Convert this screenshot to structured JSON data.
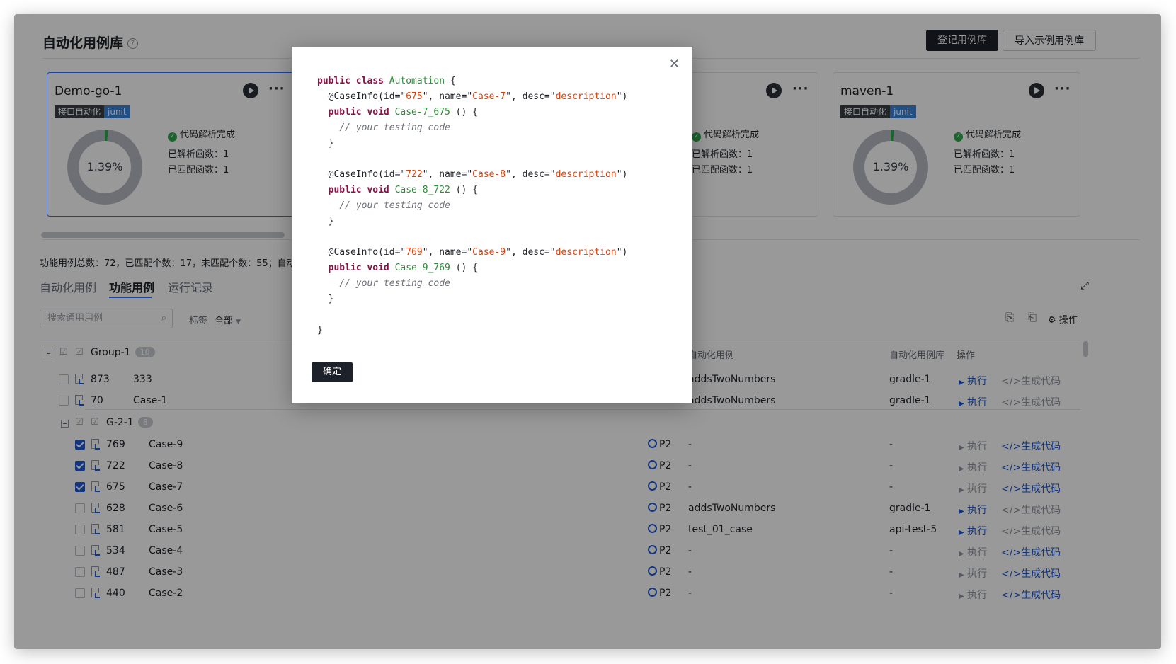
{
  "page": {
    "title": "自动化用例库",
    "help_icon": "question-circle-icon",
    "register_button": "登记用例库",
    "import_button": "导入示例用例库"
  },
  "cards": [
    {
      "name": "Demo-go-1",
      "tags": [
        "接口自动化",
        "junit"
      ],
      "percent": "1.39%",
      "status": "代码解析完成",
      "parsed": "已解析函数：1",
      "matched": "已匹配函数：1"
    },
    {
      "name": "",
      "tags": [],
      "percent": "",
      "status": "代码解析完成",
      "parsed": "已解析函数：1",
      "matched": "已匹配函数：1"
    },
    {
      "name": "maven-1",
      "tags": [
        "接口自动化",
        "junit"
      ],
      "percent": "1.39%",
      "status": "代码解析完成",
      "parsed": "已解析函数：1",
      "matched": "已匹配函数：1"
    }
  ],
  "summary": "功能用例总数：72，已匹配个数：17，未匹配个数：55；自动",
  "tabs": [
    "自动化用例",
    "功能用例",
    "运行记录"
  ],
  "active_tab": "功能用例",
  "toolbar": {
    "search_placeholder": "搜索通用用例",
    "tag_label": "标签",
    "tag_value": "全部",
    "action_label": "操作"
  },
  "table": {
    "headers": {
      "automation_case": "自动化用例",
      "automation_lib": "自动化用例库",
      "action": "操作"
    },
    "groups": [
      {
        "name": "Group-1",
        "count": "10"
      },
      {
        "name": "G-2-1",
        "count": "8"
      }
    ],
    "rows_group1": [
      {
        "id": "873",
        "name": "333",
        "case": "addsTwoNumbers",
        "lib": "gradle-1",
        "run": "执行",
        "gen": "生成代码"
      },
      {
        "id": "70",
        "name": "Case-1",
        "case": "addsTwoNumbers",
        "lib": "gradle-1",
        "run": "执行",
        "gen": "生成代码"
      }
    ],
    "rows_group2": [
      {
        "id": "769",
        "name": "Case-9",
        "priority": "P2",
        "case": "-",
        "lib": "-",
        "run": "执行",
        "gen": "生成代码",
        "checked": true
      },
      {
        "id": "722",
        "name": "Case-8",
        "priority": "P2",
        "case": "-",
        "lib": "-",
        "run": "执行",
        "gen": "生成代码",
        "checked": true
      },
      {
        "id": "675",
        "name": "Case-7",
        "priority": "P2",
        "case": "-",
        "lib": "-",
        "run": "执行",
        "gen": "生成代码",
        "checked": true
      },
      {
        "id": "628",
        "name": "Case-6",
        "priority": "P2",
        "case": "addsTwoNumbers",
        "lib": "gradle-1",
        "run": "执行",
        "gen": "生成代码",
        "checked": false
      },
      {
        "id": "581",
        "name": "Case-5",
        "priority": "P2",
        "case": "test_01_case",
        "lib": "api-test-5",
        "run": "执行",
        "gen": "生成代码",
        "checked": false
      },
      {
        "id": "534",
        "name": "Case-4",
        "priority": "P2",
        "case": "-",
        "lib": "-",
        "run": "执行",
        "gen": "生成代码",
        "checked": false
      },
      {
        "id": "487",
        "name": "Case-3",
        "priority": "P2",
        "case": "-",
        "lib": "-",
        "run": "执行",
        "gen": "生成代码",
        "checked": false
      },
      {
        "id": "440",
        "name": "Case-2",
        "priority": "P2",
        "case": "-",
        "lib": "-",
        "run": "执行",
        "gen": "生成代码",
        "checked": false
      }
    ]
  },
  "modal": {
    "confirm_button": "确定",
    "close_icon": "close-icon",
    "code": {
      "class_line": [
        "public class",
        " Automation",
        " {"
      ],
      "blocks": [
        {
          "id": "675",
          "name": "Case-7",
          "desc": "description",
          "method": "Case-7_675"
        },
        {
          "id": "722",
          "name": "Case-8",
          "desc": "description",
          "method": "Case-8_722"
        },
        {
          "id": "769",
          "name": "Case-9",
          "desc": "description",
          "method": "Case-9_769"
        }
      ],
      "annotation_prefix": "@CaseInfo(id=",
      "name_part": ", name=",
      "desc_part": ", desc=",
      "method_prefix": "public void",
      "method_suffix": " () {",
      "comment": "// your testing code",
      "close_brace": "}"
    }
  },
  "colors": {
    "accent": "#2059d4",
    "dark": "#1d2129",
    "success": "#2fa84f"
  }
}
